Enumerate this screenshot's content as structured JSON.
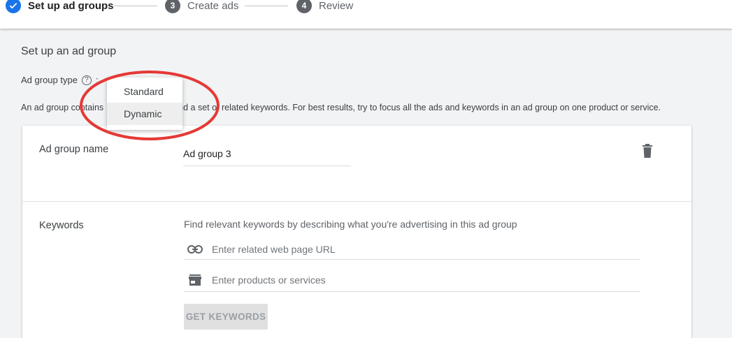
{
  "stepper": {
    "steps": [
      {
        "number": "✓",
        "label": "Set up ad groups",
        "state": "done"
      },
      {
        "number": "3",
        "label": "Create ads",
        "state": "pending"
      },
      {
        "number": "4",
        "label": "Review",
        "state": "pending"
      }
    ]
  },
  "section": {
    "title": "Set up an ad group",
    "type_label": "Ad group type",
    "help_icon": "?",
    "colon": ":",
    "description_left": "An ad group contains",
    "description_right": "nd a set of related keywords. For best results, try to focus all the ads and keywords in an ad group on one product or service."
  },
  "dropdown": {
    "options": [
      "Standard",
      "Dynamic"
    ],
    "highlighted": "Dynamic"
  },
  "card": {
    "name_label": "Ad group name",
    "name_value": "Ad group 3",
    "keywords_label": "Keywords",
    "keywords_help": "Find relevant keywords by describing what you're advertising in this ad group",
    "url_placeholder": "Enter related web page URL",
    "products_placeholder": "Enter products or services",
    "get_keywords_button": "GET KEYWORDS"
  },
  "colors": {
    "primary": "#1a73e8",
    "annotation": "#e53935",
    "disabled_button": "#e0e0e0"
  },
  "icons": {
    "step_done": "check-icon",
    "help": "help-icon",
    "delete": "trash-icon",
    "url": "link-icon",
    "products": "store-icon"
  }
}
